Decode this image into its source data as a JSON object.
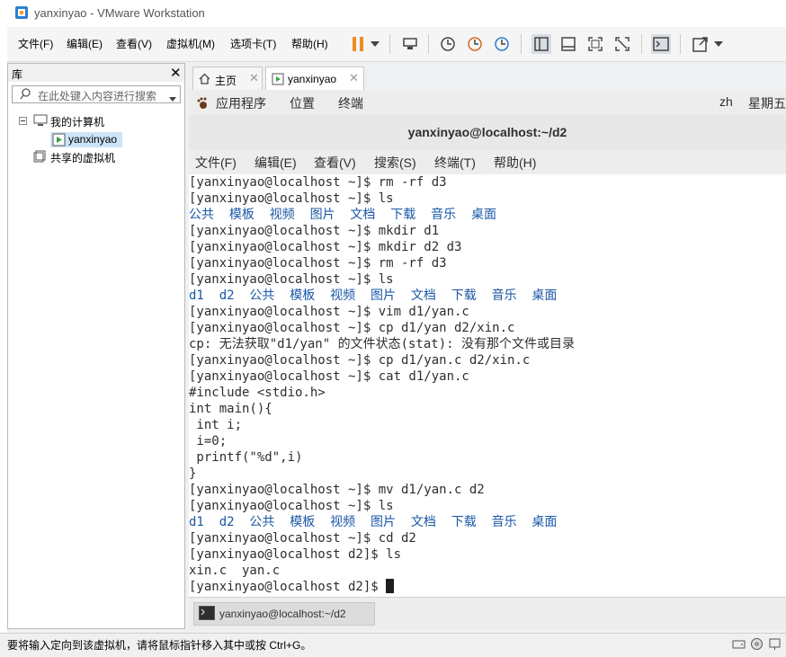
{
  "window": {
    "title": "yanxinyao - VMware Workstation",
    "accent": "#1a57a6"
  },
  "menubar": {
    "items": [
      "文件(F)",
      "编辑(E)",
      "查看(V)",
      "虚拟机(M)",
      "选项卡(T)",
      "帮助(H)"
    ]
  },
  "library": {
    "title": "库",
    "search_placeholder": "在此处键入内容进行搜索",
    "tree": {
      "root": "我的计算机",
      "vm": "yanxinyao",
      "shared": "共享的虚拟机"
    }
  },
  "tabs": [
    {
      "label": "主页"
    },
    {
      "label": "yanxinyao"
    }
  ],
  "guest": {
    "topbar": {
      "applications": "应用程序",
      "places": "位置",
      "terminal": "终端",
      "input_method": "zh",
      "clock": "星期五"
    },
    "terminal_title": "yanxinyao@localhost:~/d2",
    "terminal_menu": [
      "文件(F)",
      "编辑(E)",
      "查看(V)",
      "搜索(S)",
      "终端(T)",
      "帮助(H)"
    ],
    "lines": [
      {
        "text": "[yanxinyao@localhost ~]$ rm -rf d3",
        "style": "normal"
      },
      {
        "text": "[yanxinyao@localhost ~]$ ls",
        "style": "normal"
      },
      {
        "text": "公共  模板  视频  图片  文档  下载  音乐  桌面",
        "style": "blue"
      },
      {
        "text": "[yanxinyao@localhost ~]$ mkdir d1",
        "style": "normal"
      },
      {
        "text": "[yanxinyao@localhost ~]$ mkdir d2 d3",
        "style": "normal"
      },
      {
        "text": "[yanxinyao@localhost ~]$ rm -rf d3",
        "style": "normal"
      },
      {
        "text": "[yanxinyao@localhost ~]$ ls",
        "style": "normal"
      },
      {
        "text": "d1  d2  公共  模板  视频  图片  文档  下载  音乐  桌面",
        "style": "blue"
      },
      {
        "text": "[yanxinyao@localhost ~]$ vim d1/yan.c",
        "style": "normal"
      },
      {
        "text": "[yanxinyao@localhost ~]$ cp d1/yan d2/xin.c",
        "style": "normal"
      },
      {
        "text": "cp: 无法获取\"d1/yan\" 的文件状态(stat): 没有那个文件或目录",
        "style": "normal"
      },
      {
        "text": "[yanxinyao@localhost ~]$ cp d1/yan.c d2/xin.c",
        "style": "normal"
      },
      {
        "text": "[yanxinyao@localhost ~]$ cat d1/yan.c",
        "style": "normal"
      },
      {
        "text": "#include <stdio.h>",
        "style": "normal"
      },
      {
        "text": "int main(){",
        "style": "normal"
      },
      {
        "text": " int i;",
        "style": "normal"
      },
      {
        "text": " i=0;",
        "style": "normal"
      },
      {
        "text": " printf(\"%d\",i)",
        "style": "normal"
      },
      {
        "text": "}",
        "style": "normal"
      },
      {
        "text": "[yanxinyao@localhost ~]$ mv d1/yan.c d2",
        "style": "normal"
      },
      {
        "text": "[yanxinyao@localhost ~]$ ls",
        "style": "normal"
      },
      {
        "text": "d1  d2  公共  模板  视频  图片  文档  下载  音乐  桌面",
        "style": "blue"
      },
      {
        "text": "[yanxinyao@localhost ~]$ cd d2",
        "style": "normal"
      },
      {
        "text": "[yanxinyao@localhost d2]$ ls",
        "style": "normal"
      },
      {
        "text": "xin.c  yan.c",
        "style": "normal"
      }
    ],
    "prompt": "[yanxinyao@localhost d2]$ ",
    "taskbar_item": "yanxinyao@localhost:~/d2"
  },
  "statusbar": {
    "text": "要将输入定向到该虚拟机，请将鼠标指针移入其中或按 Ctrl+G。"
  }
}
